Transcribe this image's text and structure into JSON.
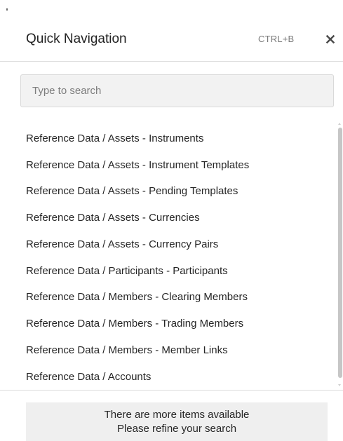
{
  "header": {
    "title": "Quick Navigation",
    "shortcut": "CTRL+B",
    "close_icon": "close-icon"
  },
  "search": {
    "placeholder": "Type to search",
    "value": ""
  },
  "results": [
    "Reference Data / Assets - Instruments",
    "Reference Data / Assets - Instrument Templates",
    "Reference Data / Assets - Pending Templates",
    "Reference Data / Assets - Currencies",
    "Reference Data / Assets - Currency Pairs",
    "Reference Data / Participants - Participants",
    "Reference Data / Members - Clearing Members",
    "Reference Data / Members - Trading Members",
    "Reference Data / Members - Member Links",
    "Reference Data / Accounts"
  ],
  "footer": {
    "line1": "There are more items available",
    "line2": "Please refine your search"
  },
  "colors": {
    "background": "#ffffff",
    "search_background": "#f2f2f2",
    "notice_background": "#efefef",
    "divider": "#dcdcdc"
  }
}
